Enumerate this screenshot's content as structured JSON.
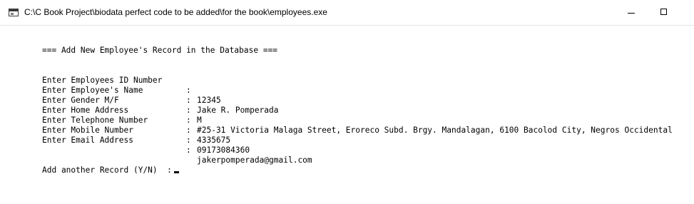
{
  "window": {
    "title": "C:\\C Book Project\\biodata perfect code to be added\\for the book\\employees.exe"
  },
  "console": {
    "header": "=== Add New Employee's Record in the Database ===",
    "separator": ":",
    "fields": [
      {
        "label": "Enter Employees ID Number",
        "value": "12345"
      },
      {
        "label": "Enter Employee's Name",
        "value": "Jake R. Pomperada"
      },
      {
        "label": "Enter Gender M/F",
        "value": "M"
      },
      {
        "label": "Enter Home Address",
        "value": "#25-31 Victoria Malaga Street, Eroreco Subd. Brgy. Mandalagan, 6100 Bacolod City, Negros Occidental"
      },
      {
        "label": "Enter Telephone Number",
        "value": "4335675"
      },
      {
        "label": "Enter Mobile Number",
        "value": "09173084360"
      },
      {
        "label": "Enter Email Address",
        "value": "jakerpomperada@gmail.com"
      }
    ],
    "prompt": "Add another Record (Y/N)  :"
  }
}
